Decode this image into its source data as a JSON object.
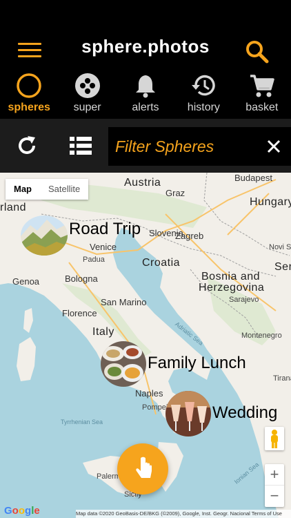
{
  "app": {
    "title": "sphere.photos"
  },
  "tabs": [
    {
      "label": "spheres",
      "icon": "circle-icon",
      "active": true
    },
    {
      "label": "super",
      "icon": "super-icon",
      "active": false
    },
    {
      "label": "alerts",
      "icon": "bell-icon",
      "active": false
    },
    {
      "label": "history",
      "icon": "history-icon",
      "active": false
    },
    {
      "label": "basket",
      "icon": "cart-icon",
      "active": false
    }
  ],
  "toolbar": {
    "filter_placeholder": "Filter Spheres"
  },
  "map": {
    "type_options": [
      "Map",
      "Satellite"
    ],
    "selected_type": "Map",
    "labels": {
      "austria": "Austria",
      "hungary": "Hungary",
      "budapest": "Budapest",
      "graz": "Graz",
      "slovenia": "Slovenia",
      "zagreb": "Zagreb",
      "croatia": "Croatia",
      "venice": "Venice",
      "padua": "Padua",
      "milan": "rland",
      "genoa": "Genoa",
      "bologna": "Bologna",
      "sanmarino": "San Marino",
      "florence": "Florence",
      "italy": "Italy",
      "bosnia": "Bosnia and",
      "herzegovina": "Herzegovina",
      "sarajevo": "Sarajevo",
      "novisad": "Novi Sad",
      "serbia": "Ser",
      "montenegro": "Montenegro",
      "tirana": "Tirana",
      "naples": "Naples",
      "pompei": "Pompei",
      "tyrrhenian": "Tyrrhenian Sea",
      "adriatic": "Adriatic Sea",
      "ionian": "Ionian Sea",
      "palermo": "Palermo",
      "sicily": "Sicily"
    },
    "markers": [
      {
        "label": "Road Trip",
        "photo": "mountain-photo"
      },
      {
        "label": "Family Lunch",
        "photo": "food-photo"
      },
      {
        "label": "Wedding",
        "photo": "drinks-photo"
      }
    ],
    "zoom_in": "+",
    "zoom_out": "−",
    "google": "Google",
    "attribution": "Map data ©2020 GeoBasis-DE/BKG (©2009), Google, Inst. Geogr. Nacional   Terms of Use"
  },
  "colors": {
    "accent": "#f6a41d",
    "background": "#000000",
    "toolbar": "#1c1c1c",
    "sea": "#aad3df",
    "land": "#f2efe9"
  }
}
